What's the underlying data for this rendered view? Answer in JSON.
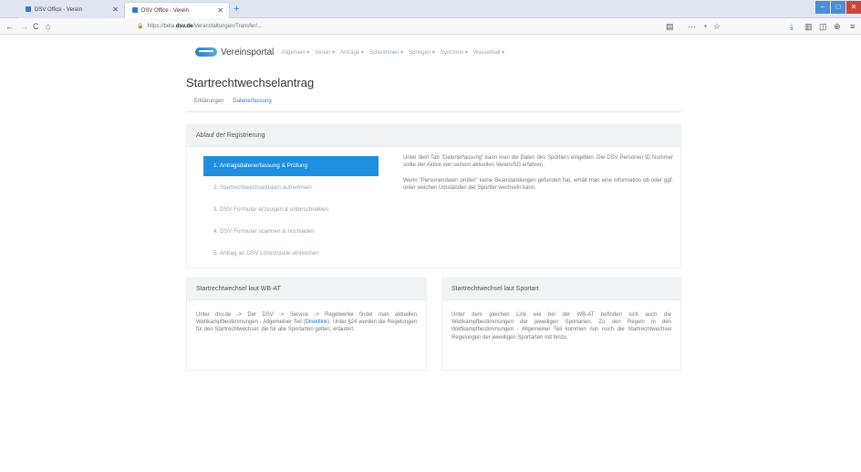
{
  "browser": {
    "tabs": [
      {
        "label": "DSV Office - Verein"
      },
      {
        "label": "DSV Office - Verein"
      }
    ],
    "new_tab_symbol": "+",
    "url_prefix": "https://beta.",
    "url_domain": "dsv.de",
    "url_path": "/Veranstaltungen/Transfer/...",
    "window_controls": [
      "–",
      "□",
      "✕"
    ],
    "nav_icons": {
      "back": "←",
      "forward": "→",
      "reload": "C",
      "home": "⌂"
    }
  },
  "site": {
    "title": "Vereinsportal",
    "menu": [
      "Allgemein ▾",
      "Verein ▾",
      "Anträge ▾",
      "Schwimmen ▾",
      "Springen ▾",
      "Synchron ▾",
      "Wasserball ▾"
    ]
  },
  "page": {
    "title": "Startrechtwechselantrag",
    "tabs": [
      {
        "label": "Erklärungen",
        "active": false
      },
      {
        "label": "Datenerfassung",
        "active": true
      }
    ]
  },
  "registration": {
    "heading": "Ablauf der Registrierung",
    "steps": [
      {
        "label": "1. Antragsdatenerfassung & Prüfung",
        "active": true
      },
      {
        "label": "2. Startrechtwechseldaten aufnehmen",
        "active": false
      },
      {
        "label": "3. DSV Formular erzeugen & unterschreiben",
        "active": false
      },
      {
        "label": "4. DSV Formular scannen & hochladen",
        "active": false
      },
      {
        "label": "5. Antrag an DSV Lizenzstelle einreichen",
        "active": false
      }
    ],
    "text_1": "Unter dem Tab \"Datenerfassung\" kann man die Daten des Sportlers eingeben. Die DSV Personen ID Nummer sollte der Aktive von seinem aktuellen Verein/SG erfahren.",
    "text_2": "Wenn \"Personendaten prüfen\" keine Beanstandungen gefunden hat, erhält man eine Information ob oder ggf. unter welchen Umständen der Sportler wechseln kann."
  },
  "wbat": {
    "heading": "Startrechtwechsel laut WB-AT",
    "text_before_link": "Unter dsv.de -> Der DSV -> Service -> Regelwerke findet man aktuellen Wettkampfbestimmungen - Allgemeiner Teil (",
    "link": "Direktlink",
    "text_after_link": "). Unter §24 werden die Regelungen für den Startrechtwechsel, die für alle Sportarten gelten, erläutert."
  },
  "sportart": {
    "heading": "Startrechtwechsel laut Sportart",
    "text": "Unter dem gleichen Link wie bei der WB-AT befinden sich auch die Wettkampfbestimmungen der jeweiligen Sportarten. Zu den Regeln in den Wettkampfbestimmungen - Allgemeiner Teil kommen nun noch die Startrechtwechsel Regelungen der jeweiligen Sportarten mit hinzu."
  }
}
